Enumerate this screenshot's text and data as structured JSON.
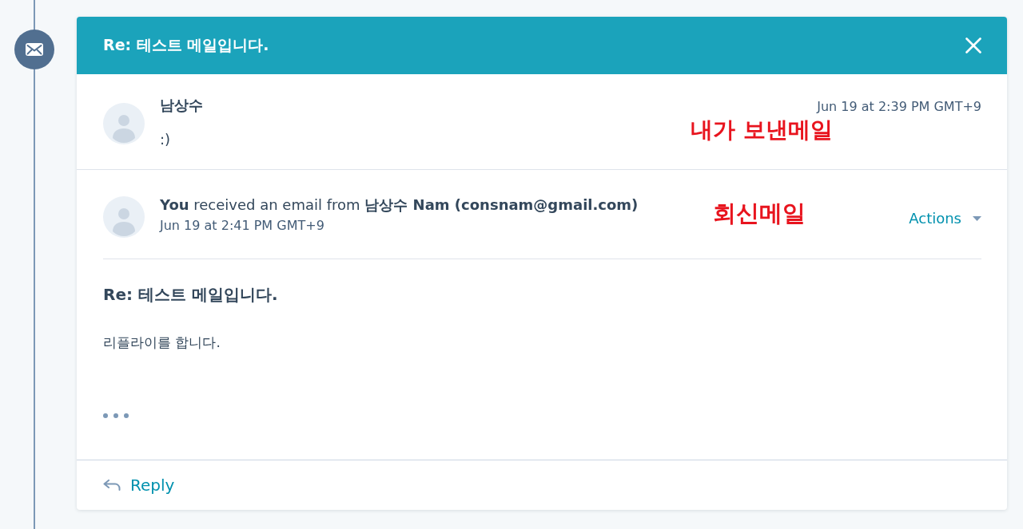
{
  "email_panel": {
    "title": "Re: 테스트 메일입니다.",
    "messages": [
      {
        "kind": "sent",
        "sender": "남상수",
        "preview": ":)",
        "timestamp": "Jun 19 at 2:39 PM GMT+9",
        "annotation": "내가 보낸메일"
      },
      {
        "kind": "received",
        "summary": "**You** received an email from **남상수 Nam (consnam@gmail.com)**",
        "timestamp": "Jun 19 at 2:41 PM GMT+9",
        "annotation": "회신메일",
        "actions_label": "Actions",
        "subject": "Re: 테스트 메일입니다.",
        "body": "리플라이를 합니다."
      }
    ],
    "reply_label": "Reply"
  }
}
